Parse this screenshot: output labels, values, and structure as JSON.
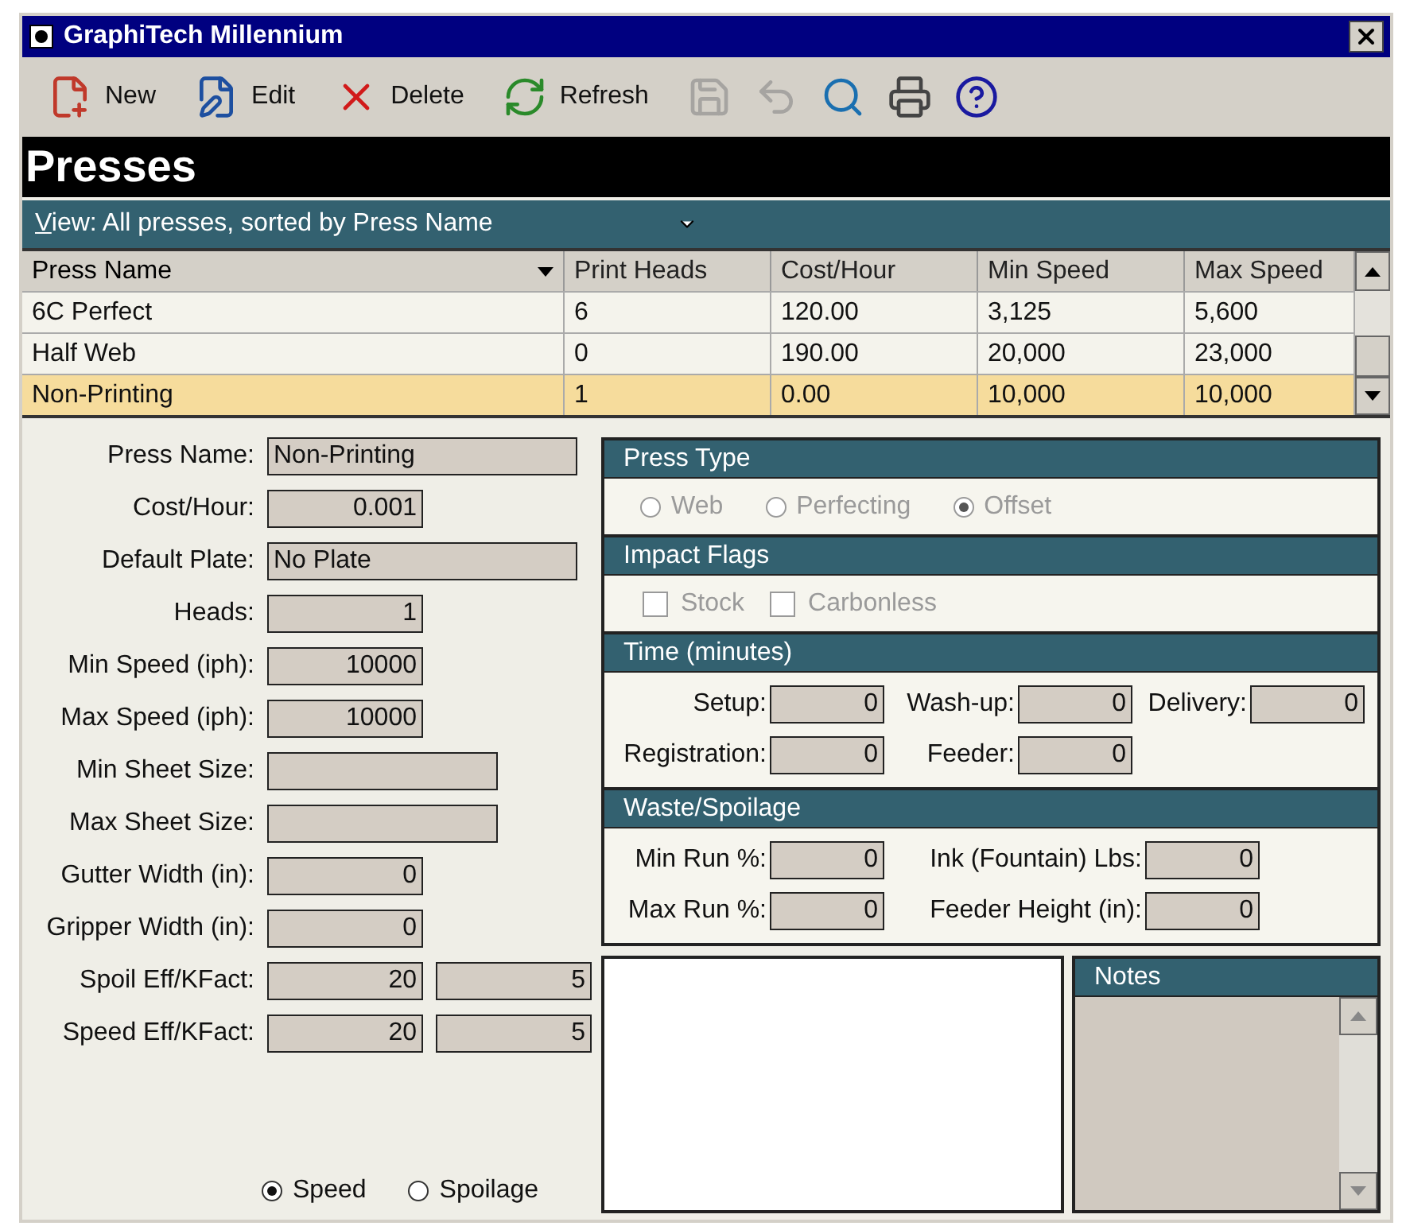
{
  "window": {
    "title": "GraphiTech Millennium"
  },
  "toolbar": [
    {
      "label": "New",
      "disabled": false
    },
    {
      "label": "Edit",
      "disabled": false
    },
    {
      "label": "Delete",
      "disabled": false
    },
    {
      "label": "Refresh",
      "disabled": false
    },
    {
      "disabled": true
    },
    {
      "disabled": true
    },
    {
      "disabled": false
    },
    {
      "disabled": false
    },
    {
      "disabled": false
    }
  ],
  "page_title": "Presses",
  "view_selector": {
    "access_key": "V",
    "rest": "iew: All presses, sorted by Press Name"
  },
  "table": {
    "columns": [
      {
        "label": "Press Name",
        "sorted": true
      },
      {
        "label": "Print Heads",
        "sorted": false
      },
      {
        "label": "Cost/Hour",
        "sorted": false
      },
      {
        "label": "Min Speed",
        "sorted": false
      },
      {
        "label": "Max Speed",
        "sorted": false
      }
    ],
    "rows": [
      {
        "cells": [
          "6C Perfect",
          "6",
          "120.00",
          "3,125",
          "5,600"
        ],
        "selected": false
      },
      {
        "cells": [
          "Half Web",
          "0",
          "190.00",
          "20,000",
          "23,000"
        ],
        "selected": false
      },
      {
        "cells": [
          "Non-Printing",
          "1",
          "0.00",
          "10,000",
          "10,000"
        ],
        "selected": true
      }
    ]
  },
  "form": [
    {
      "label": "Press Name:",
      "kind": "wide",
      "values": [
        "Non-Printing"
      ]
    },
    {
      "label": "Cost/Hour:",
      "kind": "short",
      "values": [
        "0.001"
      ]
    },
    {
      "label": "Default Plate:",
      "kind": "wide",
      "values": [
        "No Plate"
      ]
    },
    {
      "label": "Heads:",
      "kind": "short",
      "values": [
        "1"
      ]
    },
    {
      "label": "Min Speed (iph):",
      "kind": "short",
      "values": [
        "10000"
      ]
    },
    {
      "label": "Max Speed (iph):",
      "kind": "short",
      "values": [
        "10000"
      ]
    },
    {
      "label": "Min Sheet Size:",
      "kind": "medium"
    },
    {
      "label": "Max Sheet Size:",
      "kind": "medium"
    },
    {
      "label": "Gutter Width (in):",
      "kind": "short",
      "values": [
        "0"
      ]
    },
    {
      "label": "Gripper Width (in):",
      "kind": "short",
      "values": [
        "0"
      ]
    },
    {
      "label": "Spoil Eff/KFact:",
      "kind": "pair",
      "values": [
        "20",
        "5"
      ]
    },
    {
      "label": "Speed Eff/KFact:",
      "kind": "pair",
      "values": [
        "20",
        "5"
      ]
    }
  ],
  "efficiency_mode": [
    {
      "label": "Speed",
      "selected": true
    },
    {
      "label": "Spoilage",
      "selected": false
    }
  ],
  "press_type": {
    "title": "Press Type",
    "disabled": true,
    "options": [
      {
        "label": "Web",
        "selected": false
      },
      {
        "label": "Perfecting",
        "selected": false
      },
      {
        "label": "Offset",
        "selected": true
      }
    ]
  },
  "impact_flags": {
    "title": "Impact Flags",
    "disabled": true,
    "flags": [
      {
        "label": "Stock",
        "checked": false
      },
      {
        "label": "Carbonless",
        "checked": false
      }
    ]
  },
  "time": {
    "title": "Time (minutes)",
    "fields": [
      {
        "label": "Setup:",
        "value": "0"
      },
      {
        "label": "Wash-up:",
        "value": "0"
      },
      {
        "label": "Delivery:",
        "value": "0"
      },
      {
        "label": "Registration:",
        "value": "0"
      },
      {
        "label": "Feeder:",
        "value": "0"
      }
    ]
  },
  "waste": {
    "title": "Waste/Spoilage",
    "fields": [
      {
        "label": "Min Run %:",
        "value": "0"
      },
      {
        "label": "Ink (Fountain) Lbs:",
        "value": "0"
      },
      {
        "label": "Max Run %:",
        "value": "0"
      },
      {
        "label": "Feeder Height (in):",
        "value": "0"
      }
    ]
  },
  "notes": {
    "title": "Notes"
  }
}
